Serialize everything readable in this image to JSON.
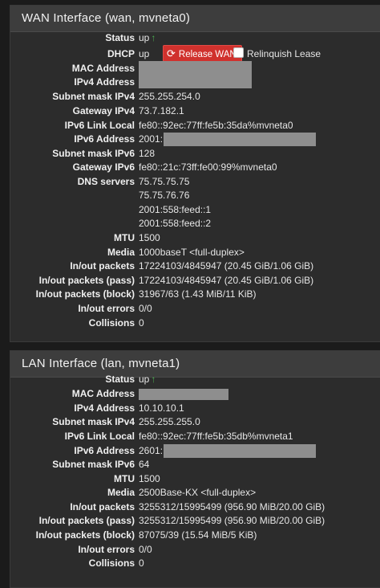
{
  "wan": {
    "title": "WAN Interface (wan, mvneta0)",
    "status_label": "Status",
    "status_value": "up",
    "dhcp_label": "DHCP",
    "dhcp_value": "up",
    "release_button": "Release WAN",
    "relinquish_label": "Relinquish Lease",
    "mac_label": "MAC Address",
    "ipv4_label": "IPv4 Address",
    "subnet4_label": "Subnet mask IPv4",
    "subnet4_value": "255.255.254.0",
    "gw4_label": "Gateway IPv4",
    "gw4_value": "73.7.182.1",
    "ll6_label": "IPv6 Link Local",
    "ll6_value": "fe80::92ec:77ff:fe5b:35da%mvneta0",
    "ipv6_label": "IPv6 Address",
    "ipv6_prefix": "2001:",
    "subnet6_label": "Subnet mask IPv6",
    "subnet6_value": "128",
    "gw6_label": "Gateway IPv6",
    "gw6_value": "fe80::21c:73ff:fe00:99%mvneta0",
    "dns_label": "DNS servers",
    "dns": [
      "75.75.75.75",
      "75.75.76.76",
      "2001:558:feed::1",
      "2001:558:feed::2"
    ],
    "mtu_label": "MTU",
    "mtu_value": "1500",
    "media_label": "Media",
    "media_value": "1000baseT <full-duplex>",
    "pkts_label": "In/out packets",
    "pkts_value": "17224103/4845947 (20.45 GiB/1.06 GiB)",
    "pkts_pass_label": "In/out packets (pass)",
    "pkts_pass_value": "17224103/4845947 (20.45 GiB/1.06 GiB)",
    "pkts_block_label": "In/out packets (block)",
    "pkts_block_value": "31967/63 (1.43 MiB/11 KiB)",
    "errors_label": "In/out errors",
    "errors_value": "0/0",
    "collisions_label": "Collisions",
    "collisions_value": "0"
  },
  "lan": {
    "title": "LAN Interface (lan, mvneta1)",
    "status_label": "Status",
    "status_value": "up",
    "mac_label": "MAC Address",
    "ipv4_label": "IPv4 Address",
    "ipv4_value": "10.10.10.1",
    "subnet4_label": "Subnet mask IPv4",
    "subnet4_value": "255.255.255.0",
    "ll6_label": "IPv6 Link Local",
    "ll6_value": "fe80::92ec:77ff:fe5b:35db%mvneta1",
    "ipv6_label": "IPv6 Address",
    "ipv6_prefix": "2601:",
    "subnet6_label": "Subnet mask IPv6",
    "subnet6_value": "64",
    "mtu_label": "MTU",
    "mtu_value": "1500",
    "media_label": "Media",
    "media_value": "2500Base-KX <full-duplex>",
    "pkts_label": "In/out packets",
    "pkts_value": "3255312/15995499 (956.90 MiB/20.00 GiB)",
    "pkts_pass_label": "In/out packets (pass)",
    "pkts_pass_value": "3255312/15995499 (956.90 MiB/20.00 GiB)",
    "pkts_block_label": "In/out packets (block)",
    "pkts_block_value": "87075/39 (15.54 MiB/5 KiB)",
    "errors_label": "In/out errors",
    "errors_value": "0/0",
    "collisions_label": "Collisions",
    "collisions_value": "0"
  },
  "icons": {
    "status_up": "arrow-up-icon",
    "release": "refresh-icon"
  },
  "colors": {
    "status_up": "#4caf50",
    "release_button": "#d0312d",
    "redaction": "#8e8e8e"
  }
}
